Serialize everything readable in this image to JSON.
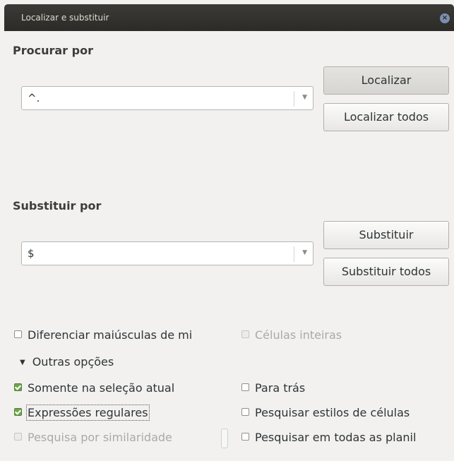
{
  "window": {
    "title": "Localizar e substituir"
  },
  "search": {
    "label": "Procurar por",
    "value": "^."
  },
  "replace": {
    "label": "Substituir por",
    "value": "$"
  },
  "buttons": {
    "find": "Localizar",
    "find_all": "Localizar todos",
    "replace": "Substituir",
    "replace_all": "Substituir todos"
  },
  "options": {
    "match_case": {
      "label": "Diferenciar maiúsculas de mi",
      "checked": false
    },
    "whole_cells": {
      "label": "Células inteiras",
      "checked": false,
      "disabled": true
    },
    "other_options": "Outras opções",
    "current_selection": {
      "label": "Somente na seleção atual",
      "checked": true
    },
    "backwards": {
      "label": "Para trás",
      "checked": false
    },
    "regex": {
      "label": "Expressões regulares",
      "checked": true
    },
    "cell_styles": {
      "label": "Pesquisar estilos de células",
      "checked": false
    },
    "similarity": {
      "label": "Pesquisa por similaridade",
      "checked": false,
      "disabled": true
    },
    "all_sheets": {
      "label": "Pesquisar em todas as planil",
      "checked": false
    }
  },
  "colors": {
    "titlebar": "#2c2b28",
    "checkbox_on": "#6fa64d",
    "background": "#f2f1f0"
  }
}
